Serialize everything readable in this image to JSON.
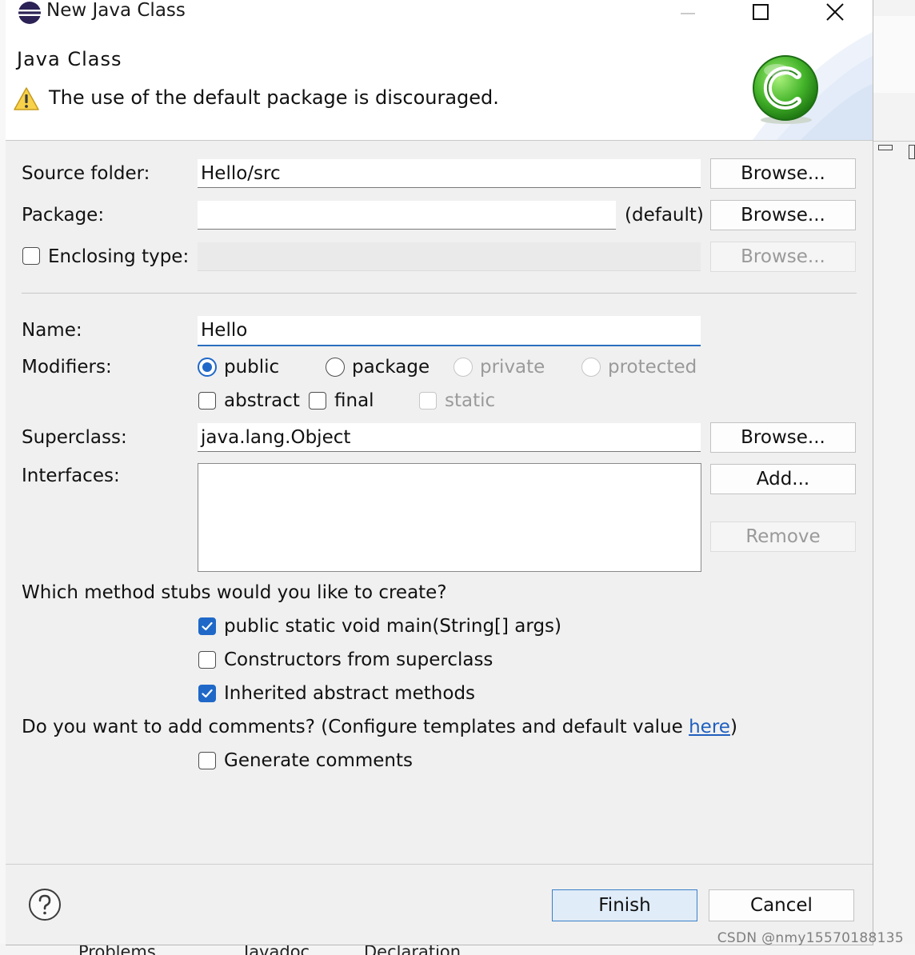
{
  "window": {
    "title": "New Java Class",
    "icons": {
      "app": "eclipse-icon",
      "minimize": "minimize-icon",
      "maximize": "maximize-icon",
      "close": "close-icon"
    }
  },
  "banner": {
    "heading": "Java Class",
    "message": "The use of the default package is discouraged.",
    "warning_icon": "warning-icon",
    "logo_icon": "java-class-c-icon"
  },
  "form": {
    "source_folder": {
      "label": "Source folder:",
      "value": "Hello/src",
      "browse": "Browse..."
    },
    "package": {
      "label": "Package:",
      "value": "",
      "default_hint": "(default)",
      "browse": "Browse..."
    },
    "enclosing_type": {
      "label": "Enclosing type:",
      "checked": false,
      "value": "",
      "browse": "Browse..."
    },
    "name": {
      "label": "Name:",
      "value": "Hello"
    },
    "modifiers": {
      "label": "Modifiers:",
      "public": "public",
      "package": "package",
      "private": "private",
      "protected": "protected",
      "abstract": "abstract",
      "final": "final",
      "static": "static"
    },
    "superclass": {
      "label": "Superclass:",
      "value": "java.lang.Object",
      "browse": "Browse..."
    },
    "interfaces": {
      "label": "Interfaces:",
      "add": "Add...",
      "remove": "Remove"
    }
  },
  "stubs": {
    "question": "Which method stubs would you like to create?",
    "main": "public static void main(String[] args)",
    "constructors": "Constructors from superclass",
    "inherited": "Inherited abstract methods"
  },
  "comments": {
    "question_prefix": "Do you want to add comments? (Configure templates and default value ",
    "link": "here",
    "question_suffix": ")",
    "generate": "Generate comments"
  },
  "footer": {
    "finish": "Finish",
    "cancel": "Cancel",
    "help_icon": "help-icon"
  },
  "background": {
    "tab_problems": "Problems",
    "tab_javadoc": "Javadoc",
    "tab_declaration": "Declaration",
    "watermark": "CSDN @nmy15570188135"
  },
  "colors": {
    "accent": "#1f68c8",
    "link": "#1f5fbf",
    "logo_green": "#3aae2a"
  }
}
